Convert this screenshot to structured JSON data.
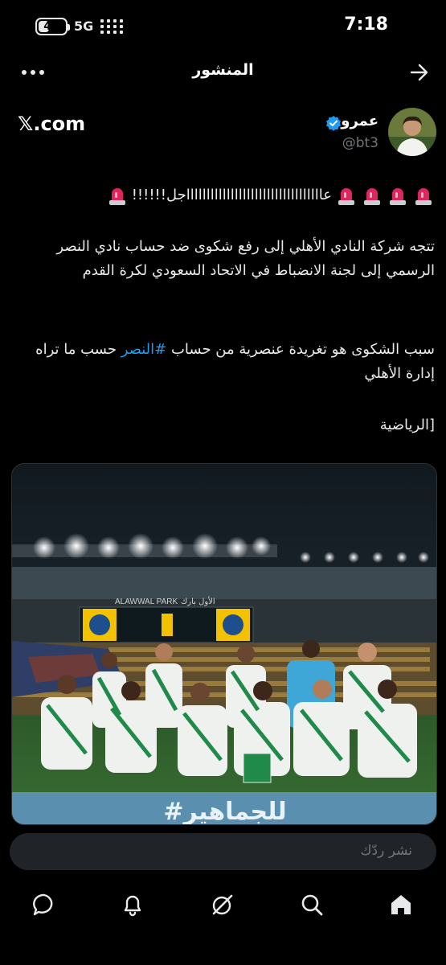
{
  "status_bar": {
    "battery": "40",
    "battery_level": 0.4,
    "network": "5G",
    "time": "7:18"
  },
  "header": {
    "title": "المنشور",
    "back_icon": "arrow-right-icon",
    "more_icon": "more-horizontal-icon"
  },
  "post": {
    "source_logo": "𝕏.com",
    "author": {
      "name": "عمرو",
      "handle": "@bt3",
      "verified": true
    },
    "alarm_text": "عااااااااااااااااااااااااااااااااااجل!!!!!!",
    "paragraph_1": "تتجه شركة النادي الأهلي إلى رفع شكوى ضد حساب نادي النصر الرسمي إلى لجنة الانضباط في الاتحاد السعودي لكرة القدم",
    "paragraph_2_before": "سبب الشكوى هو تغريدة عنصرية من حساب ",
    "paragraph_2_hashtag": "#النصر",
    "paragraph_2_after": " حسب ما تراه إدارة الأهلي",
    "paragraph_3": "[الرياضية",
    "media": {
      "stadium_sign": "ALAWWAL PARK",
      "stadium_sign_ar": "الأول بارك",
      "banner": "#للجماهير"
    }
  },
  "reply": {
    "placeholder": "نشر ردّك"
  },
  "bottom_nav": [
    {
      "name": "home",
      "icon": "home-icon"
    },
    {
      "name": "search",
      "icon": "search-icon"
    },
    {
      "name": "grok",
      "icon": "grok-icon"
    },
    {
      "name": "notifications",
      "icon": "bell-icon"
    },
    {
      "name": "messages",
      "icon": "chat-icon"
    }
  ],
  "colors": {
    "background": "#000000",
    "text": "#e7e9ea",
    "secondary": "#71767b",
    "link": "#1d9bf0",
    "verified": "#1d9bf0",
    "alarm": "#e0245e"
  }
}
